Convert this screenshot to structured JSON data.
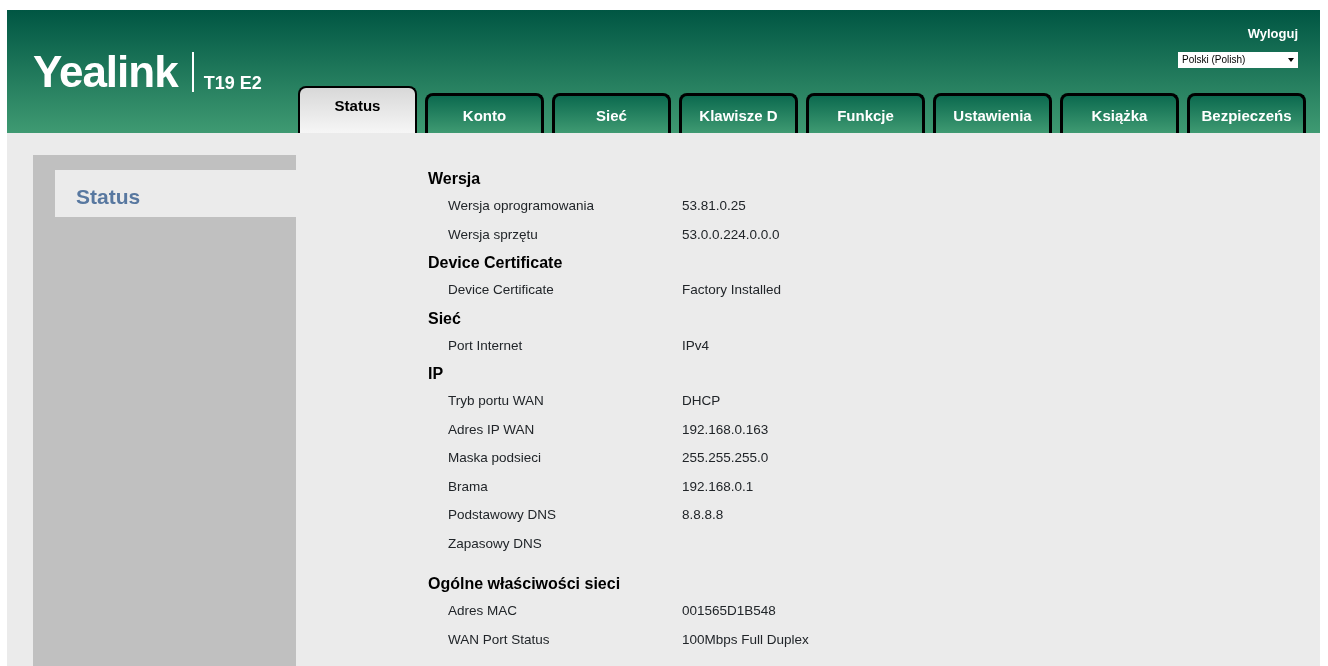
{
  "header": {
    "logo": "Yealink",
    "model": "T19 E2",
    "logout": "Wyloguj",
    "language": "Polski (Polish)"
  },
  "tabs": [
    {
      "label": "Status",
      "selected": true
    },
    {
      "label": "Konto",
      "selected": false
    },
    {
      "label": "Sieć",
      "selected": false
    },
    {
      "label": "Klawisze D",
      "selected": false
    },
    {
      "label": "Funkcje",
      "selected": false
    },
    {
      "label": "Ustawienia",
      "selected": false
    },
    {
      "label": "Książka",
      "selected": false
    },
    {
      "label": "Bezpieczeńs",
      "selected": false
    }
  ],
  "sidebar": {
    "items": [
      {
        "label": "Status",
        "selected": true
      }
    ]
  },
  "sections": [
    {
      "title": "Wersja",
      "rows": [
        {
          "label": "Wersja oprogramowania",
          "value": "53.81.0.25"
        },
        {
          "label": "Wersja sprzętu",
          "value": "53.0.0.224.0.0.0"
        }
      ]
    },
    {
      "title": "Device Certificate",
      "rows": [
        {
          "label": "Device Certificate",
          "value": "Factory Installed"
        }
      ]
    },
    {
      "title": "Sieć",
      "rows": [
        {
          "label": "Port Internet",
          "value": "IPv4"
        }
      ]
    },
    {
      "title": "IP",
      "rows": [
        {
          "label": "Tryb portu WAN",
          "value": "DHCP"
        },
        {
          "label": "Adres IP WAN",
          "value": "192.168.0.163"
        },
        {
          "label": "Maska podsieci",
          "value": "255.255.255.0"
        },
        {
          "label": "Brama",
          "value": "192.168.0.1"
        },
        {
          "label": "Podstawowy DNS",
          "value": "8.8.8.8"
        },
        {
          "label": "Zapasowy DNS"
        }
      ]
    },
    {
      "title": "Ogólne właściwości sieci",
      "rows": [
        {
          "label": "Adres MAC",
          "value": "001565D1B548"
        },
        {
          "label": "WAN Port Status",
          "value": "100Mbps Full Duplex"
        }
      ]
    }
  ]
}
